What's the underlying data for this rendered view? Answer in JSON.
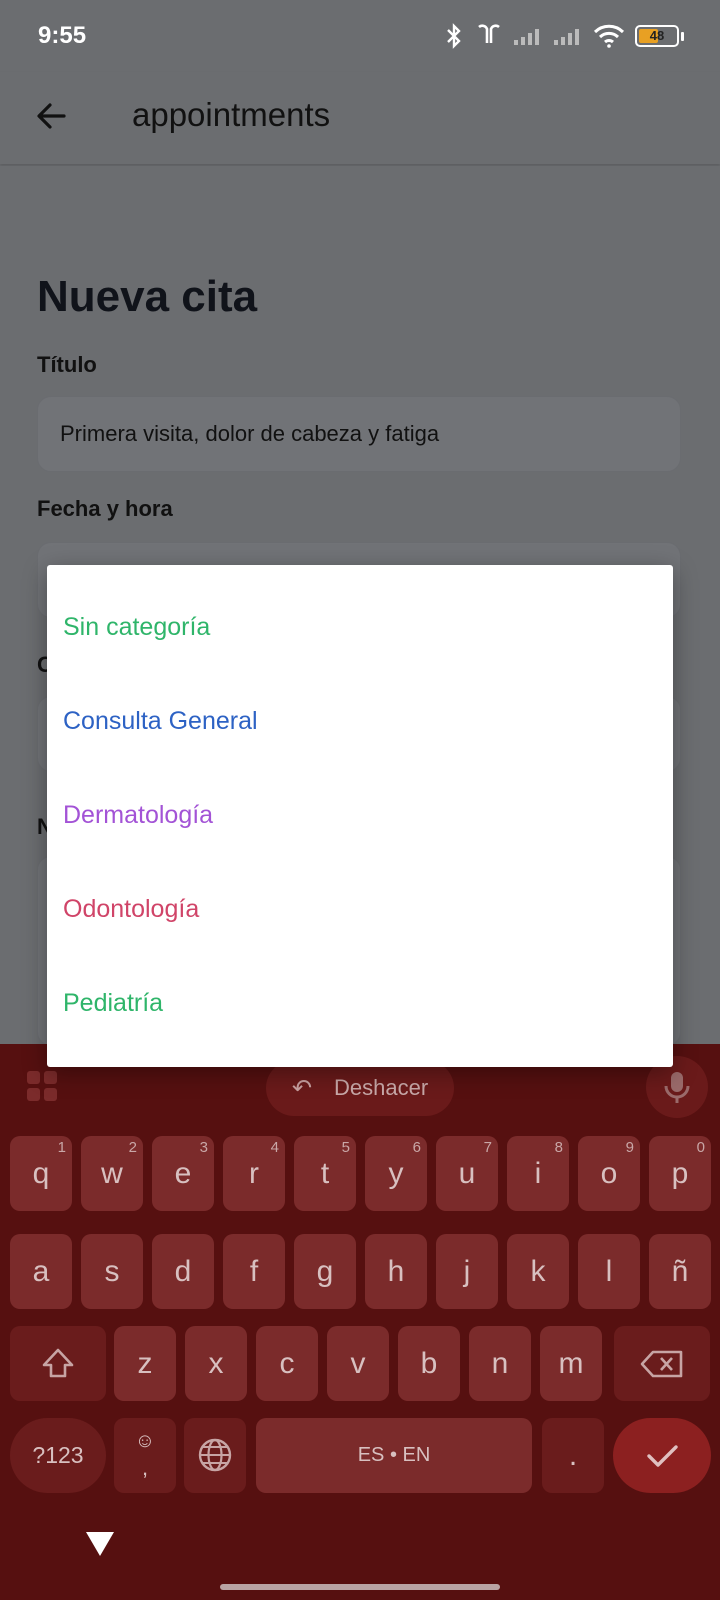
{
  "status_bar": {
    "time": "9:55",
    "battery": "48"
  },
  "app_bar": {
    "title": "appointments"
  },
  "form": {
    "heading": "Nueva cita",
    "title_label": "Título",
    "title_value": "Primera visita, dolor de cabeza y fatiga",
    "datetime_label": "Fecha y hora",
    "category_label_partial": "C",
    "notes_label_partial": "N"
  },
  "category_dialog": {
    "options": [
      {
        "label": "Sin categoría",
        "color": "#2fb56a"
      },
      {
        "label": "Consulta General",
        "color": "#2d62c4"
      },
      {
        "label": "Dermatología",
        "color": "#a353d6"
      },
      {
        "label": "Odontología",
        "color": "#d04468"
      },
      {
        "label": "Pediatría",
        "color": "#2fb56a"
      }
    ]
  },
  "keyboard": {
    "undo_label": "Deshacer",
    "row1": [
      "q",
      "w",
      "e",
      "r",
      "t",
      "y",
      "u",
      "i",
      "o",
      "p"
    ],
    "row1_numbers": [
      "1",
      "2",
      "3",
      "4",
      "5",
      "6",
      "7",
      "8",
      "9",
      "0"
    ],
    "row2": [
      "a",
      "s",
      "d",
      "f",
      "g",
      "h",
      "j",
      "k",
      "l",
      "ñ"
    ],
    "row3": [
      "z",
      "x",
      "c",
      "v",
      "b",
      "n",
      "m"
    ],
    "symbols_key": "?123",
    "space_label": "ES • EN",
    "period_key": ".",
    "emoji_comma": ","
  },
  "colors": {
    "scrim_bg": "#6b6d70",
    "keyboard_bg": "#561010",
    "key_bg": "#7b2b2b"
  }
}
